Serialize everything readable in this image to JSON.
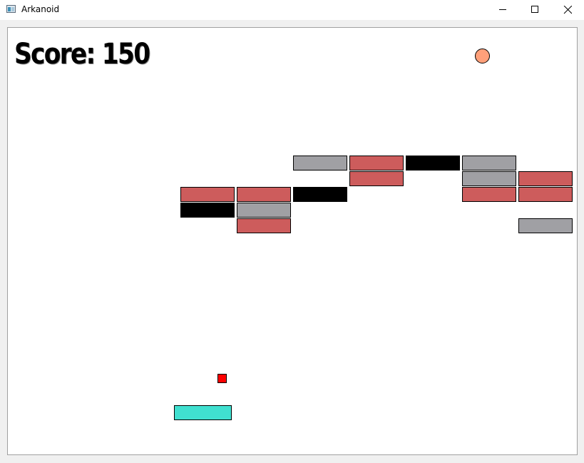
{
  "window": {
    "title": "Arkanoid",
    "icon": "app-window-icon",
    "controls": [
      "minimize-icon",
      "maximize-icon",
      "close-icon"
    ]
  },
  "game": {
    "score_text": "Score: 150",
    "score": 150,
    "colors": {
      "background": "#ffffff",
      "paddle": "#40e0d0",
      "ball": "#ffa07a",
      "powerup": "#ff0000",
      "brick_red": "#cd5c5c",
      "brick_gray": "#a0a0a4",
      "brick_black": "#000000"
    },
    "bricks": [
      {
        "col": 2,
        "row": 0,
        "type": "gray"
      },
      {
        "col": 3,
        "row": 0,
        "type": "red"
      },
      {
        "col": 4,
        "row": 0,
        "type": "black"
      },
      {
        "col": 5,
        "row": 0,
        "type": "gray"
      },
      {
        "col": 3,
        "row": 1,
        "type": "red"
      },
      {
        "col": 5,
        "row": 1,
        "type": "gray"
      },
      {
        "col": 6,
        "row": 1,
        "type": "red"
      },
      {
        "col": 0,
        "row": 2,
        "type": "red"
      },
      {
        "col": 1,
        "row": 2,
        "type": "red"
      },
      {
        "col": 2,
        "row": 2,
        "type": "black"
      },
      {
        "col": 5,
        "row": 2,
        "type": "red"
      },
      {
        "col": 6,
        "row": 2,
        "type": "red"
      },
      {
        "col": 0,
        "row": 3,
        "type": "black"
      },
      {
        "col": 1,
        "row": 3,
        "type": "gray"
      },
      {
        "col": 1,
        "row": 4,
        "type": "red"
      },
      {
        "col": 6,
        "row": 4,
        "type": "gray"
      }
    ]
  }
}
